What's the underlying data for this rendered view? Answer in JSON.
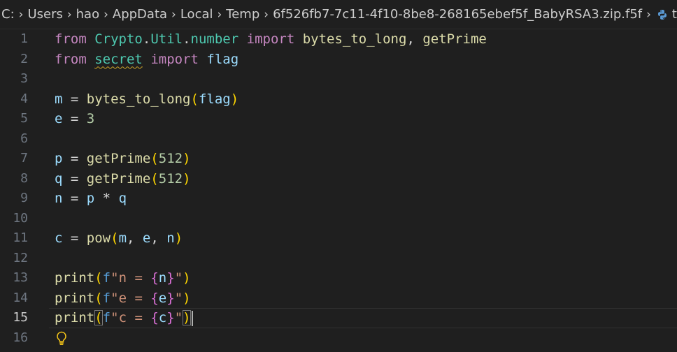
{
  "breadcrumb": {
    "items": [
      "C:",
      "Users",
      "hao",
      "AppData",
      "Local",
      "Temp",
      "6f526fb7-7c11-4f10-8be8-268165ebef5f_BabyRSA3.zip.f5f"
    ],
    "trailing": "t",
    "separator": "›"
  },
  "tokens": {
    "kw_from": "from",
    "kw_import": "import",
    "mod_crypto": "Crypto",
    "mod_util": "Util",
    "mod_number": "number",
    "dot": ".",
    "fn_bytes_to_long": "bytes_to_long",
    "fn_getPrime": "getPrime",
    "comma_space": ", ",
    "mod_secret": "secret",
    "var_flag": "flag",
    "var_m": "m",
    "var_e": "e",
    "var_p": "p",
    "var_q": "q",
    "var_n": "n",
    "var_c": "c",
    "assign": " = ",
    "mul": " * ",
    "num_3": "3",
    "num_512": "512",
    "fn_pow": "pow",
    "fn_print": "print",
    "lparen": "(",
    "rparen": ")",
    "lbrace": "{",
    "rbrace": "}",
    "f_prefix": "f",
    "quote": "\"",
    "str_n": "n = ",
    "str_e": "e = ",
    "str_c": "c = "
  },
  "line_numbers": [
    "1",
    "2",
    "3",
    "4",
    "5",
    "6",
    "7",
    "8",
    "9",
    "10",
    "11",
    "12",
    "13",
    "14",
    "15",
    "16"
  ],
  "current_line": "15",
  "colors": {
    "background": "#1f1f1f",
    "keyword": "#c586c0",
    "class": "#4ec9b0",
    "function": "#dcdcaa",
    "variable": "#9cdcfe",
    "number": "#b5cea8",
    "string": "#ce9178",
    "bracket1": "#ffd700",
    "bracket2": "#da70d6",
    "lightbulb": "#f5c518"
  },
  "icons": {
    "python": "python-icon",
    "lightbulb": "lightbulb-icon"
  }
}
